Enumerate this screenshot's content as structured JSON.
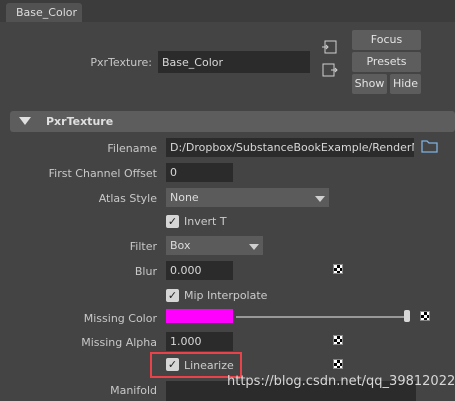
{
  "tab": {
    "label": "Base_Color"
  },
  "header": {
    "pxr_label": "PxrTexture:",
    "pxr_value": "Base_Color",
    "focus": "Focus",
    "presets": "Presets",
    "show": "Show",
    "hide": "Hide"
  },
  "section": {
    "title": "PxrTexture"
  },
  "fields": {
    "filename_label": "Filename",
    "filename_value": "D:/Dropbox/SubstanceBookExample/RenderMan/t",
    "first_channel_label": "First Channel Offset",
    "first_channel_value": "0",
    "atlas_label": "Atlas Style",
    "atlas_value": "None",
    "invert_t_label": "Invert T",
    "filter_label": "Filter",
    "filter_value": "Box",
    "blur_label": "Blur",
    "blur_value": "0.000",
    "mip_label": "Mip Interpolate",
    "missing_color_label": "Missing Color",
    "missing_alpha_label": "Missing Alpha",
    "missing_alpha_value": "1.000",
    "linearize_label": "Linearize",
    "manifold_label": "Manifold"
  },
  "checks": {
    "invert_t": true,
    "mip": true,
    "linearize": true
  },
  "colors": {
    "missing_color": "#ff00ff",
    "highlight": "#e8424a"
  },
  "icons": {
    "folder": "folder-icon",
    "connector": "connector-icon",
    "map": "checker-map-icon"
  },
  "watermark": "https://blog.csdn.net/qq_39812022"
}
